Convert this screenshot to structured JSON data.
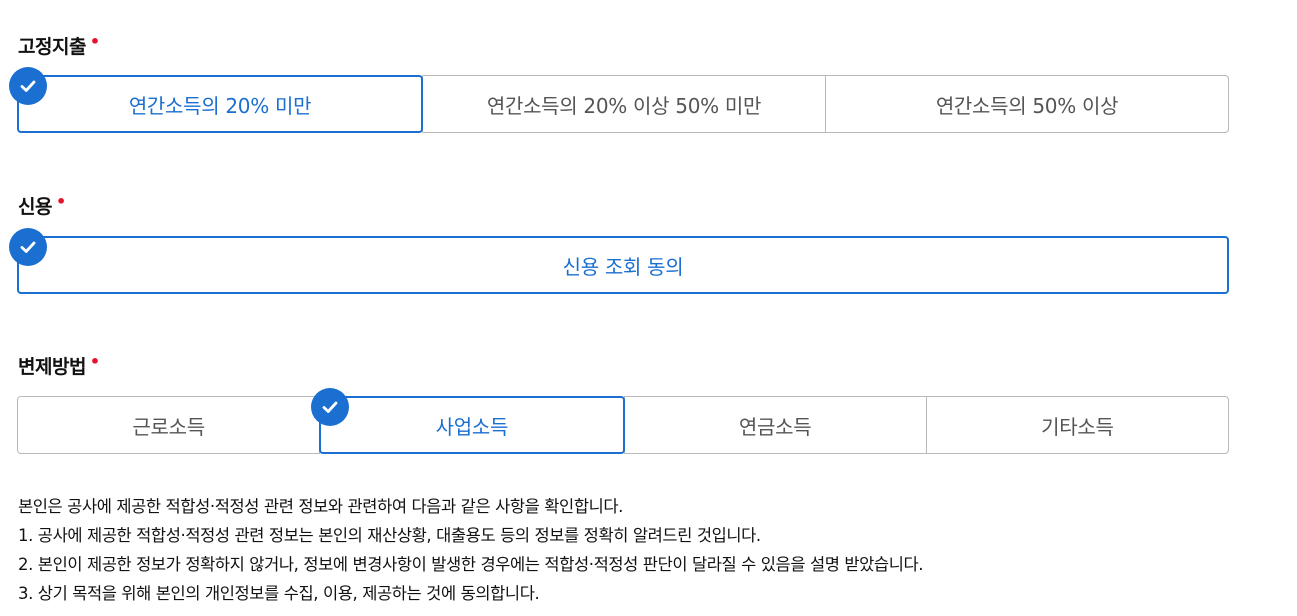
{
  "fixed_expense": {
    "label": "고정지출",
    "required_mark": "•",
    "options": [
      {
        "label": "연간소득의 20% 미만",
        "selected": true
      },
      {
        "label": "연간소득의 20% 이상 50% 미만",
        "selected": false
      },
      {
        "label": "연간소득의 50% 이상",
        "selected": false
      }
    ]
  },
  "credit": {
    "label": "신용",
    "required_mark": "•",
    "options": [
      {
        "label": "신용 조회 동의",
        "selected": true
      }
    ]
  },
  "repayment": {
    "label": "변제방법",
    "required_mark": "•",
    "options": [
      {
        "label": "근로소득",
        "selected": false
      },
      {
        "label": "사업소득",
        "selected": true
      },
      {
        "label": "연금소득",
        "selected": false
      },
      {
        "label": "기타소득",
        "selected": false
      }
    ]
  },
  "notice": {
    "lines": [
      "본인은 공사에 제공한 적합성·적정성 관련 정보와 관련하여 다음과 같은 사항을 확인합니다.",
      "1. 공사에 제공한 적합성·적정성 관련 정보는 본인의 재산상황, 대출용도 등의 정보를 정확히 알려드린 것입니다.",
      "2. 본인이 제공한 정보가 정확하지 않거나, 정보에 변경사항이 발생한 경우에는 적합성·적정성 판단이 달라질 수 있음을 설명 받았습니다.",
      "3. 상기 목적을 위해 본인의 개인정보를 수집, 이용, 제공하는 것에 동의합니다."
    ]
  },
  "colors": {
    "accent": "#1a6fd0",
    "required": "#e8112d",
    "border": "#b9b9b9"
  },
  "icons": {
    "selected": "check-circle-icon"
  }
}
